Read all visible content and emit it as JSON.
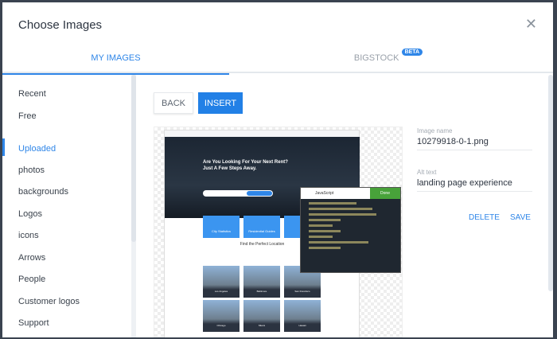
{
  "dialog": {
    "title": "Choose Images",
    "close_icon": "close-icon"
  },
  "tabs": [
    {
      "label": "MY IMAGES",
      "active": true
    },
    {
      "label": "BIGSTOCK",
      "badge": "BETA",
      "active": false
    }
  ],
  "sidebar": {
    "items": [
      {
        "label": "Recent"
      },
      {
        "label": "Free"
      },
      {
        "label": "Uploaded",
        "active": true
      },
      {
        "label": "photos"
      },
      {
        "label": "backgrounds"
      },
      {
        "label": "Logos"
      },
      {
        "label": "icons"
      },
      {
        "label": "Arrows"
      },
      {
        "label": "People"
      },
      {
        "label": "Customer logos"
      },
      {
        "label": "Support"
      }
    ]
  },
  "toolbar": {
    "back_label": "BACK",
    "insert_label": "INSERT"
  },
  "preview": {
    "headline": "Are You Looking For Your Next Rent? Just A Few Steps Away.",
    "cards": [
      "City Statistics",
      "Residential Guides"
    ],
    "section_title": "Find the Perfect Location",
    "code_title": "JavaScript",
    "code_done": "Done",
    "cities": [
      "Los Angeles",
      "Baltimore",
      "San Francisco",
      "Chicago",
      "Miami",
      "Hawaii"
    ]
  },
  "details": {
    "image_name_label": "Image name",
    "image_name": "10279918-0-1.png",
    "alt_label": "Alt text",
    "alt_text": "landing page experience",
    "delete_label": "DELETE",
    "save_label": "SAVE"
  },
  "colors": {
    "accent": "#2f86e8"
  }
}
